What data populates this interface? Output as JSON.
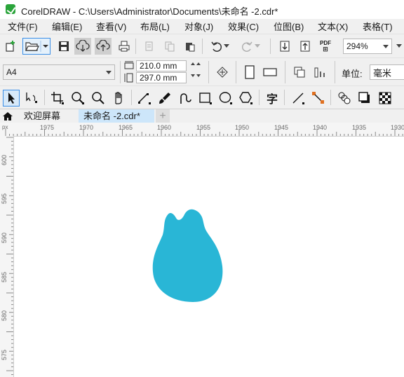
{
  "window": {
    "title": "CorelDRAW - C:\\Users\\Administrator\\Documents\\未命名 -2.cdr*"
  },
  "menu": {
    "items": [
      {
        "label": "文件(F)"
      },
      {
        "label": "编辑(E)"
      },
      {
        "label": "查看(V)"
      },
      {
        "label": "布局(L)"
      },
      {
        "label": "对象(J)"
      },
      {
        "label": "效果(C)"
      },
      {
        "label": "位图(B)"
      },
      {
        "label": "文本(X)"
      },
      {
        "label": "表格(T)"
      }
    ]
  },
  "standard_toolbar": {
    "zoom_value": "294%",
    "pdf_label": "PDF"
  },
  "property_bar": {
    "page_size": "A4",
    "width_value": "210.0 mm",
    "height_value": "297.0 mm",
    "units_label": "单位:",
    "units_value": "毫米"
  },
  "tabs": {
    "welcome": "欢迎屏幕",
    "document": "未命名 -2.cdr*",
    "add": "+"
  },
  "rulers": {
    "horizontal_ticks": [
      "1975",
      "1970",
      "1965",
      "1960",
      "1955",
      "1950",
      "1945",
      "1940",
      "1935",
      "1930"
    ],
    "vertical_ticks": [
      "600",
      "595",
      "590",
      "585",
      "580",
      "575"
    ]
  },
  "colors": {
    "shape_fill": "#29b6d6",
    "menu_bg": "#f0f0f0",
    "active_tab": "#cde6fa"
  },
  "canvas": {
    "shape": "cyan-blob"
  }
}
